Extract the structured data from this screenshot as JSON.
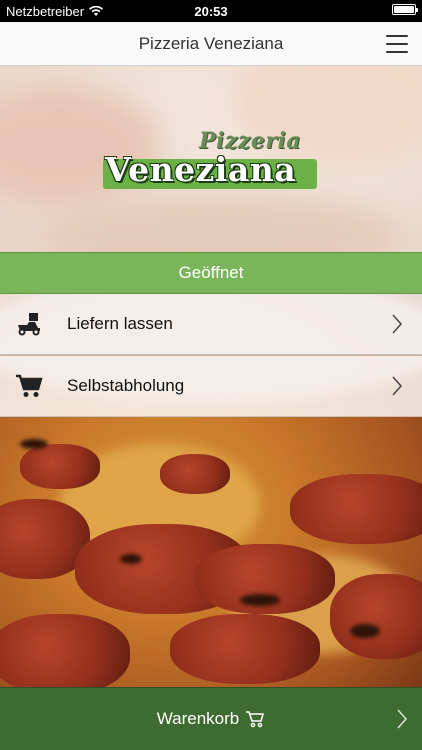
{
  "status_bar": {
    "carrier": "Netzbetreiber",
    "time": "20:53",
    "battery_level": 1.0
  },
  "nav": {
    "title": "Pizzeria Veneziana"
  },
  "logo": {
    "top_text": "Pizzeria",
    "main_text": "Veneziana"
  },
  "status_label": "Geöffnet",
  "options": [
    {
      "label": "Liefern lassen",
      "icon": "delivery-scooter-icon"
    },
    {
      "label": "Selbstabholung",
      "icon": "shopping-cart-icon"
    }
  ],
  "cart": {
    "label": "Warenkorb",
    "icon": "cart-icon"
  },
  "colors": {
    "open_green": "#7ab55c",
    "cart_green": "#3e6b32",
    "logo_green": "#6cb146"
  }
}
